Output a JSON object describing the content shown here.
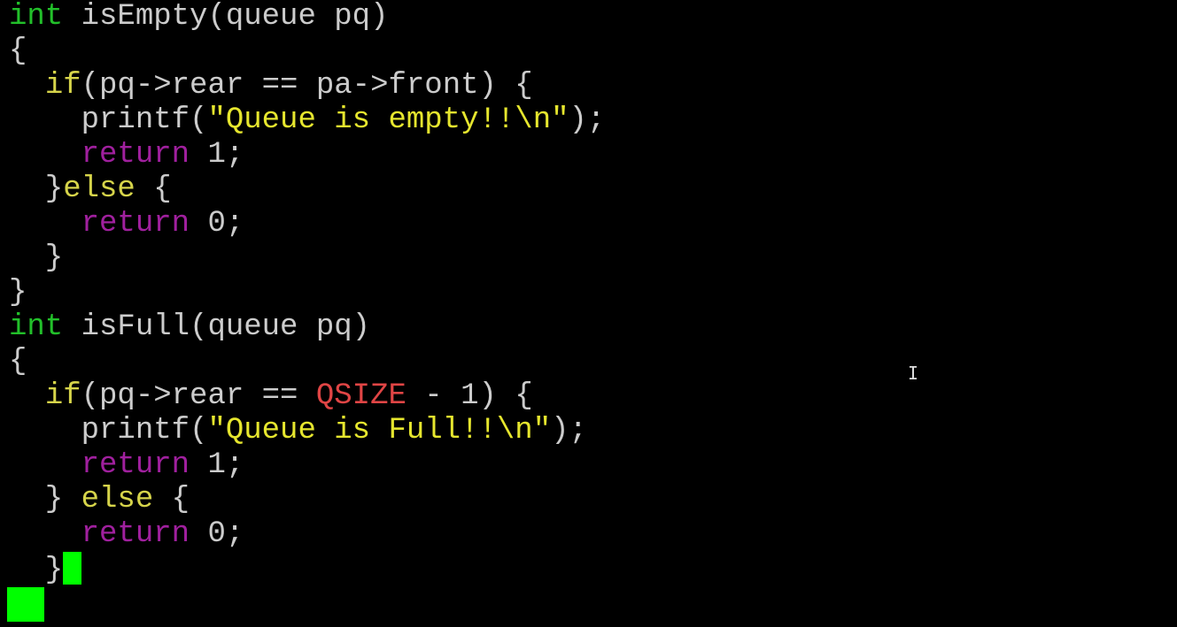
{
  "colors": {
    "background": "#000000",
    "default": "#cccccc",
    "type": "#22c02a",
    "keyword": "#d6d44a",
    "string": "#e6e62e",
    "return": "#a0209e",
    "constant": "#e04545",
    "cursor": "#00ff00"
  },
  "lines": [
    [
      {
        "t": "int",
        "c": "type"
      },
      {
        "t": " isEmpty(queue pq)",
        "c": "default"
      }
    ],
    [
      {
        "t": "{",
        "c": "default"
      }
    ],
    [
      {
        "t": "  ",
        "c": "default"
      },
      {
        "t": "if",
        "c": "keyword"
      },
      {
        "t": "(pq->rear == pa->front) {",
        "c": "default"
      }
    ],
    [
      {
        "t": "    printf(",
        "c": "default"
      },
      {
        "t": "\"Queue is empty!!\\n\"",
        "c": "string"
      },
      {
        "t": ");",
        "c": "default"
      }
    ],
    [
      {
        "t": "    ",
        "c": "default"
      },
      {
        "t": "return",
        "c": "return"
      },
      {
        "t": " 1;",
        "c": "default"
      }
    ],
    [
      {
        "t": "  }",
        "c": "default"
      },
      {
        "t": "else",
        "c": "keyword"
      },
      {
        "t": " {",
        "c": "default"
      }
    ],
    [
      {
        "t": "    ",
        "c": "default"
      },
      {
        "t": "return",
        "c": "return"
      },
      {
        "t": " 0;",
        "c": "default"
      }
    ],
    [
      {
        "t": "  }",
        "c": "default"
      }
    ],
    [
      {
        "t": "}",
        "c": "default"
      }
    ],
    [
      {
        "t": "int",
        "c": "type"
      },
      {
        "t": " isFull(queue pq)",
        "c": "default"
      }
    ],
    [
      {
        "t": "{",
        "c": "default"
      }
    ],
    [
      {
        "t": "  ",
        "c": "default"
      },
      {
        "t": "if",
        "c": "keyword"
      },
      {
        "t": "(pq->rear == ",
        "c": "default"
      },
      {
        "t": "QSIZE",
        "c": "constant"
      },
      {
        "t": " - 1) {",
        "c": "default"
      }
    ],
    [
      {
        "t": "    printf(",
        "c": "default"
      },
      {
        "t": "\"Queue is Full!!\\n\"",
        "c": "string"
      },
      {
        "t": ");",
        "c": "default"
      }
    ],
    [
      {
        "t": "    ",
        "c": "default"
      },
      {
        "t": "return",
        "c": "return"
      },
      {
        "t": " 1;",
        "c": "default"
      }
    ],
    [
      {
        "t": "  } ",
        "c": "default"
      },
      {
        "t": "else",
        "c": "keyword"
      },
      {
        "t": " {",
        "c": "default"
      }
    ],
    [
      {
        "t": "    ",
        "c": "default"
      },
      {
        "t": "return",
        "c": "return"
      },
      {
        "t": " 0;",
        "c": "default"
      }
    ],
    [
      {
        "t": "  }",
        "c": "default"
      },
      {
        "t": "",
        "c": "cursor-block"
      }
    ]
  ],
  "cursor_line_index": 16,
  "mouse_cursor_icon": "text-ibeam-cursor-icon"
}
